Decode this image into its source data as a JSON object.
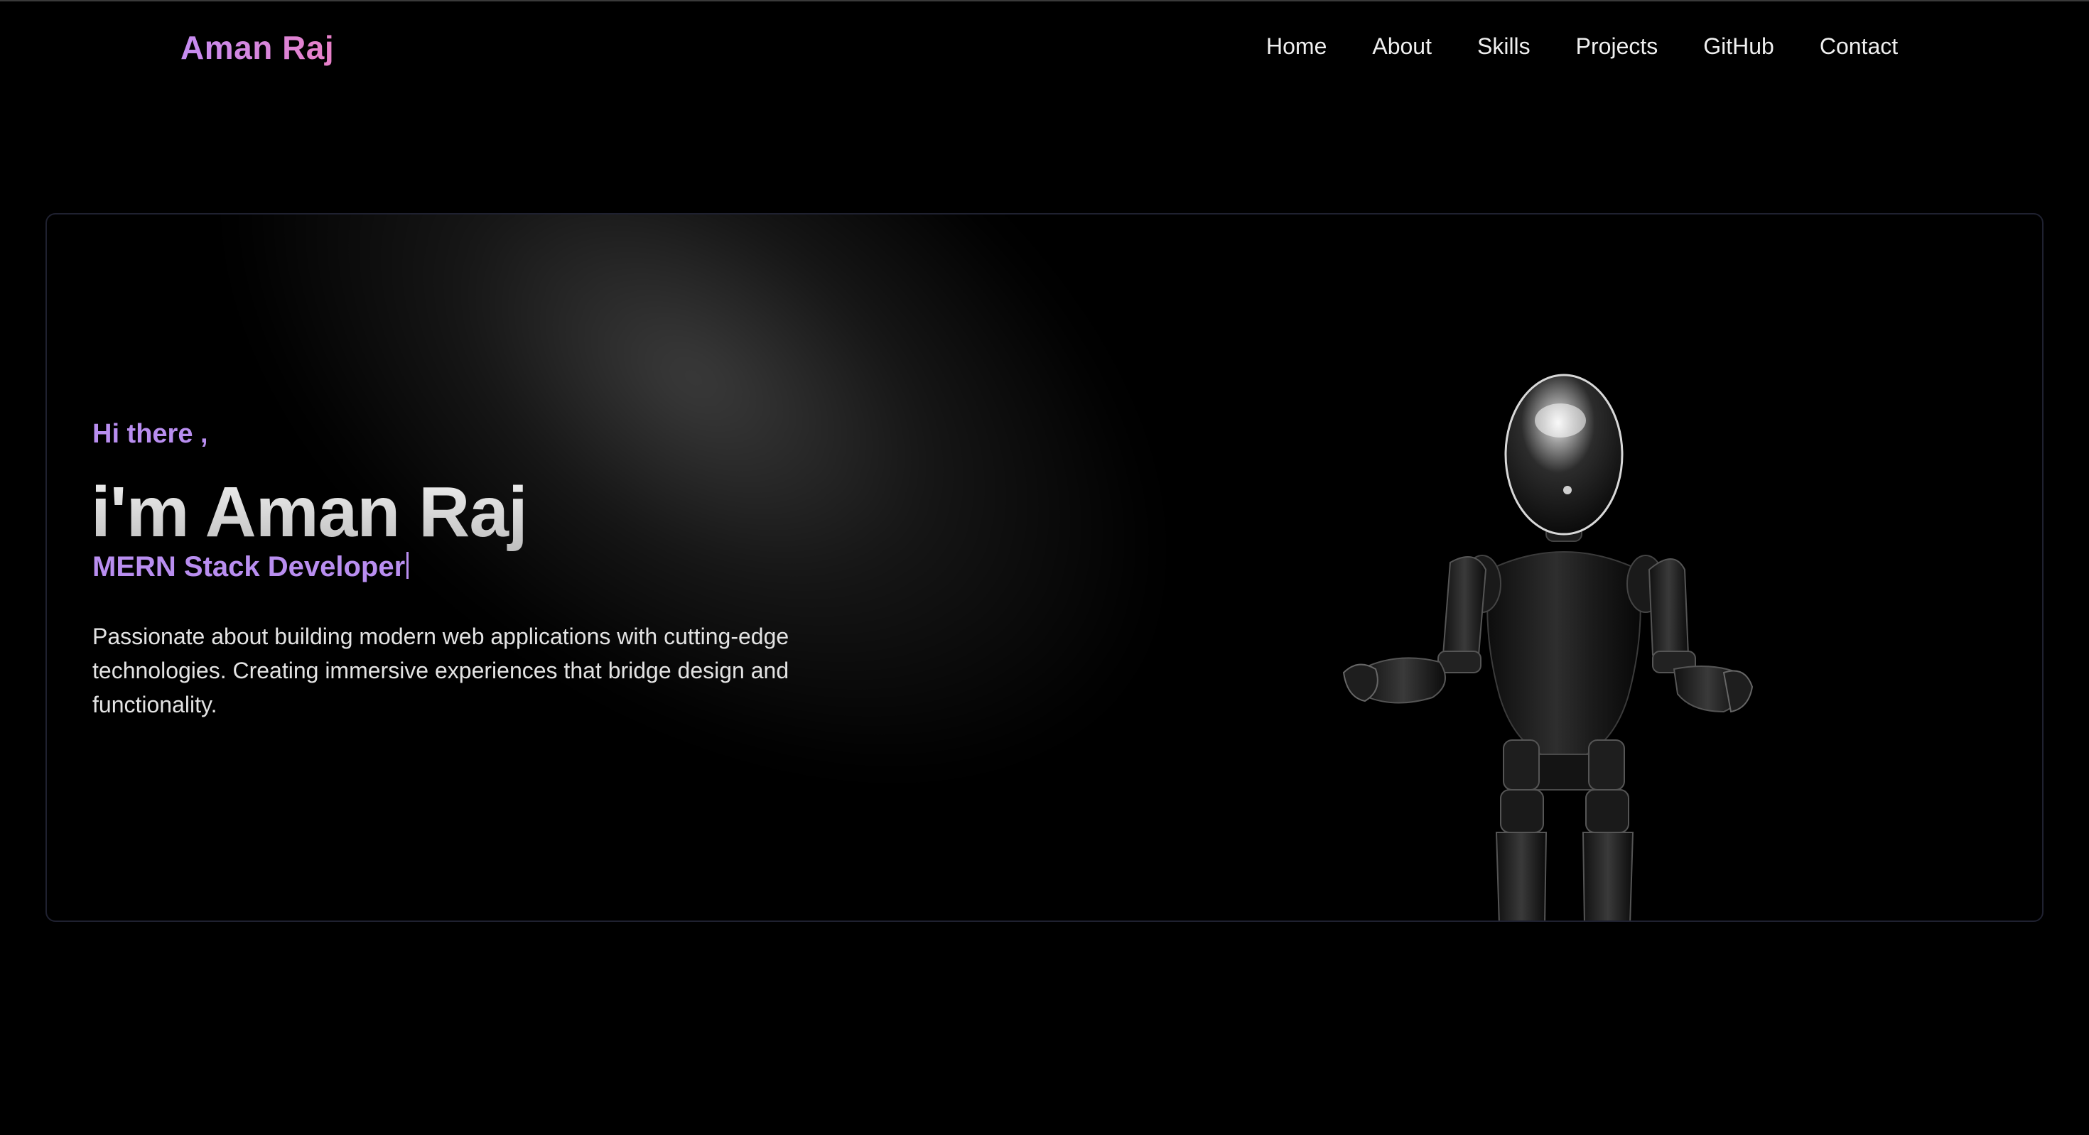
{
  "brand": "Aman Raj",
  "nav": {
    "items": [
      "Home",
      "About",
      "Skills",
      "Projects",
      "GitHub",
      "Contact"
    ]
  },
  "hero": {
    "greeting": "Hi there ,",
    "name": "i'm Aman Raj",
    "role": "MERN Stack Developer",
    "description": "Passionate about building modern web applications with cutting-edge technologies. Creating immersive experiences that bridge design and functionality."
  },
  "colors": {
    "accent": "#b98ef0",
    "brand_gradient_start": "#c58cf2",
    "brand_gradient_end": "#e880c8",
    "background": "#000000",
    "card_border": "#1f2130"
  },
  "icons": {
    "robot": "robot-figure"
  }
}
